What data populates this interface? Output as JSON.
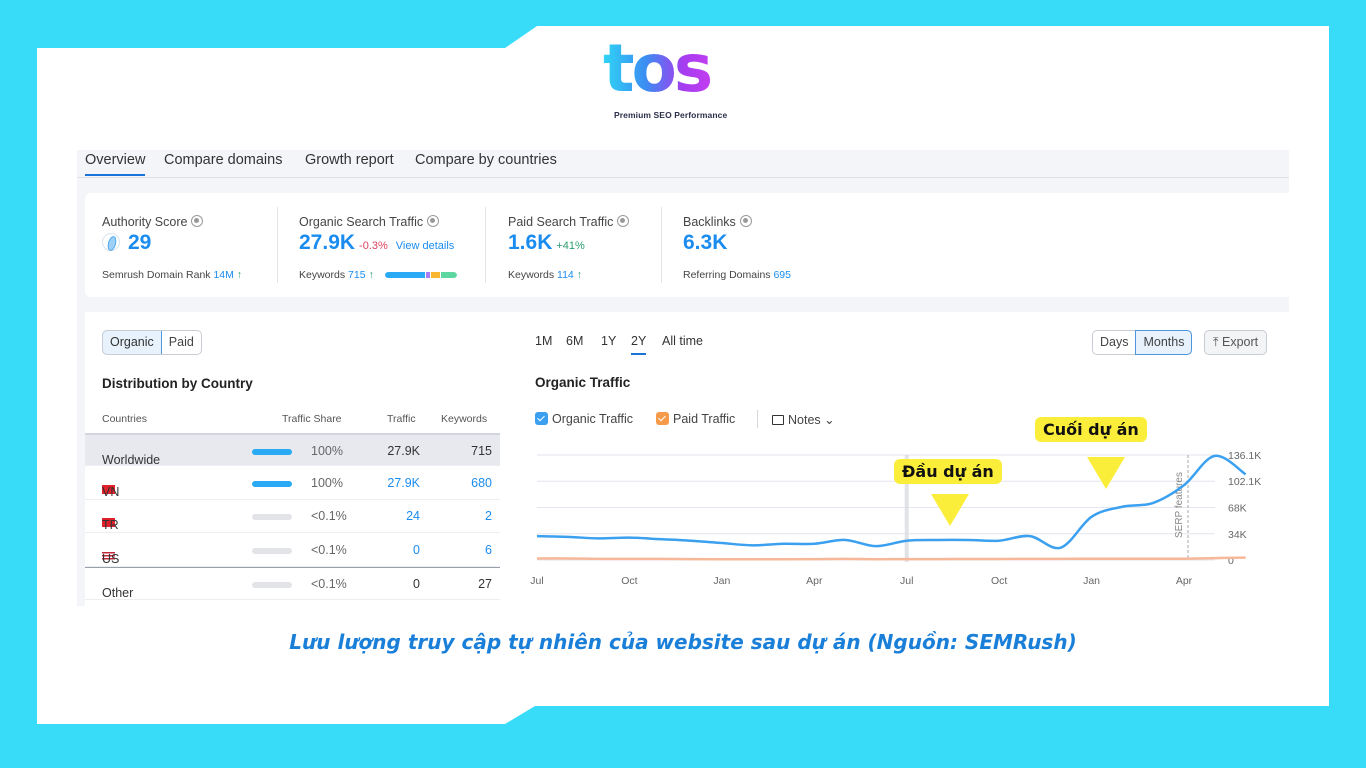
{
  "logo": {
    "text": "tos",
    "tagline": "Premium SEO Performance"
  },
  "tabs": [
    "Overview",
    "Compare domains",
    "Growth report",
    "Compare by countries"
  ],
  "active_tab": "Overview",
  "metrics": {
    "authority": {
      "label": "Authority Score",
      "value": "29",
      "sub_label": "Semrush Domain Rank",
      "sub_value": "14M",
      "sub_trend": "↑"
    },
    "organic": {
      "label": "Organic Search Traffic",
      "value": "27.9K",
      "delta": "-0.3%",
      "link": "View details",
      "sub_label": "Keywords",
      "sub_value": "715",
      "sub_trend": "↑"
    },
    "paid": {
      "label": "Paid Search Traffic",
      "value": "1.6K",
      "delta": "+41%",
      "sub_label": "Keywords",
      "sub_value": "114",
      "sub_trend": "↑"
    },
    "backlinks": {
      "label": "Backlinks",
      "value": "6.3K",
      "sub_label": "Referring Domains",
      "sub_value": "695"
    }
  },
  "colors": {
    "accent": "#1a8cf0",
    "negative": "#e0405e",
    "positive": "#2a9d6f",
    "organic_line": "#3aa0ef",
    "paid_line": "#f7b89a",
    "callout": "#fbee3a",
    "background": "#38dcf8"
  },
  "distribution": {
    "toggle": [
      "Organic",
      "Paid"
    ],
    "toggle_active": "Organic",
    "title": "Distribution by Country",
    "columns": [
      "Countries",
      "Traffic Share",
      "Traffic",
      "Keywords"
    ],
    "rows": [
      {
        "country": "Worldwide",
        "flag": "",
        "share": "100%",
        "share_value": 100,
        "traffic": "27.9K",
        "keywords": "715"
      },
      {
        "country": "VN",
        "flag": "vn-flag",
        "share": "100%",
        "share_value": 100,
        "traffic": "27.9K",
        "keywords": "680"
      },
      {
        "country": "TR",
        "flag": "tr-flag",
        "share": "<0.1%",
        "share_value": 0.1,
        "traffic": "24",
        "keywords": "2"
      },
      {
        "country": "US",
        "flag": "us-flag",
        "share": "<0.1%",
        "share_value": 0.1,
        "traffic": "0",
        "keywords": "6"
      },
      {
        "country": "Other",
        "flag": "",
        "share": "<0.1%",
        "share_value": 0.1,
        "traffic": "0",
        "keywords": "27"
      }
    ]
  },
  "chart_controls": {
    "ranges": [
      "1M",
      "6M",
      "1Y",
      "2Y",
      "All time"
    ],
    "active_range": "2Y",
    "granularity": [
      "Days",
      "Months"
    ],
    "active_granularity": "Months",
    "export_label": "Export",
    "legend": {
      "organic": "Organic Traffic",
      "paid": "Paid Traffic",
      "notes": "Notes"
    }
  },
  "annotations": {
    "start": "Đầu dự án",
    "end": "Cuối dự án",
    "serp": "SERP features"
  },
  "caption": "Lưu lượng truy cập tự nhiên của website sau dự án (Nguồn: SEMRush)",
  "chart_data": {
    "type": "line",
    "title": "Organic Traffic",
    "xlabel": "",
    "ylabel": "",
    "x_tick_labels": [
      "Jul",
      "Oct",
      "Jan",
      "Apr",
      "Jul",
      "Oct",
      "Jan",
      "Apr"
    ],
    "y_tick_labels": [
      "0",
      "34K",
      "68K",
      "102.1K",
      "136.1K"
    ],
    "y_ticks": [
      0,
      34000,
      68000,
      102100,
      136100
    ],
    "ylim": [
      0,
      136100
    ],
    "x_months": 23,
    "grid": true,
    "legend_position": "top-left",
    "series": [
      {
        "name": "Organic Traffic",
        "values": [
          31000,
          30000,
          28000,
          29000,
          27000,
          25000,
          22000,
          19000,
          21000,
          21000,
          26000,
          18000,
          25000,
          26000,
          26000,
          25000,
          31000,
          16000,
          56000,
          69000,
          74000,
          97000,
          135000,
          111000
        ]
      },
      {
        "name": "Paid Traffic",
        "values": [
          2000,
          2000,
          1500,
          1500,
          1500,
          1200,
          1000,
          1000,
          1000,
          1200,
          1500,
          1000,
          1200,
          1200,
          1300,
          1300,
          1500,
          1500,
          1600,
          1600,
          1600,
          1700,
          2500,
          3000
        ]
      }
    ]
  }
}
